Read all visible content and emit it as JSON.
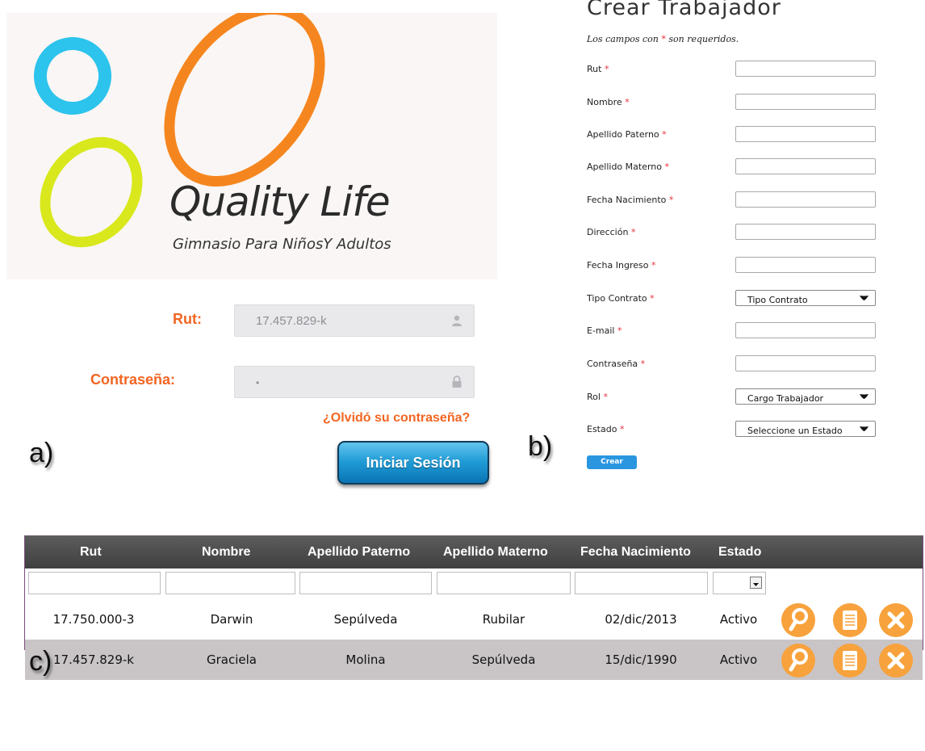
{
  "panels": {
    "a": "a)",
    "b": "b)",
    "c": "c)"
  },
  "logo": {
    "title": "Quality Life",
    "subtitle": "Gimnasio Para NiñosY Adultos"
  },
  "login": {
    "rut_label": "Rut:",
    "rut_value": "17.457.829-k",
    "password_label": "Contraseña:",
    "password_value": "•",
    "forgot_link": "¿Olvidó su contraseña?",
    "submit_label": "Iniciar Sesión"
  },
  "form": {
    "title": "Crear Trabajador",
    "note_before": "Los campos con ",
    "note_star": "*",
    "note_after": " son requeridos.",
    "fields": [
      {
        "label": "Rut",
        "type": "text"
      },
      {
        "label": "Nombre",
        "type": "text"
      },
      {
        "label": "Apellido Paterno",
        "type": "text"
      },
      {
        "label": "Apellido Materno",
        "type": "text"
      },
      {
        "label": "Fecha Nacimiento",
        "type": "text"
      },
      {
        "label": "Dirección",
        "type": "text"
      },
      {
        "label": "Fecha Ingreso",
        "type": "text"
      },
      {
        "label": "Tipo Contrato",
        "type": "select",
        "value": "Tipo Contrato"
      },
      {
        "label": "E-mail",
        "type": "text"
      },
      {
        "label": "Contraseña",
        "type": "text"
      },
      {
        "label": "Rol",
        "type": "select",
        "value": "Cargo Trabajador"
      },
      {
        "label": "Estado",
        "type": "select",
        "value": "Seleccione un Estado"
      }
    ],
    "submit_label": "Crear"
  },
  "table": {
    "columns": [
      "Rut",
      "Nombre",
      "Apellido Paterno",
      "Apellido Materno",
      "Fecha Nacimiento",
      "Estado"
    ],
    "rows": [
      [
        "17.750.000-3",
        "Darwin",
        "Sepúlveda",
        "Rubilar",
        "02/dic/2013",
        "Activo"
      ],
      [
        "17.457.829-k",
        "Graciela",
        "Molina",
        "Sepúlveda",
        "15/dic/1990",
        "Activo"
      ]
    ],
    "actions": [
      "view-icon",
      "edit-icon",
      "delete-icon"
    ]
  },
  "colors": {
    "accent": "#f26522",
    "action": "#f7a23c",
    "button_blue": "#1f9bd6",
    "required": "#e8303a"
  }
}
